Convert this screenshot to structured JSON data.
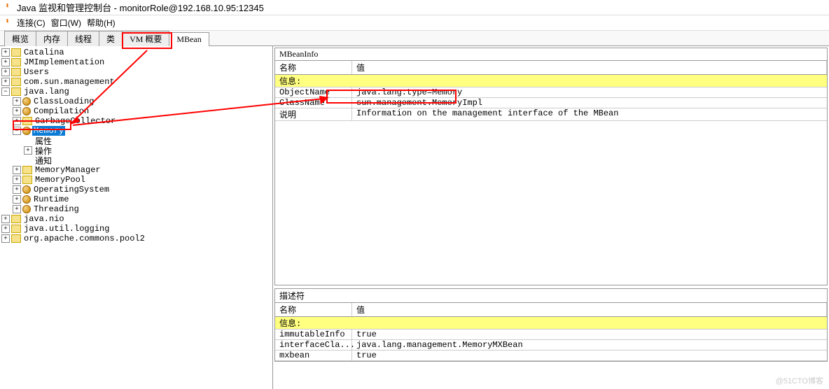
{
  "title": "Java 监视和管理控制台 - monitorRole@192.168.10.95:12345",
  "menu": {
    "connect": "连接(C)",
    "window": "窗口(W)",
    "help": "帮助(H)"
  },
  "tabs": [
    "概览",
    "内存",
    "线程",
    "类",
    "VM 概要",
    "MBean"
  ],
  "tree": {
    "catalina": "Catalina",
    "jmimpl": "JMImplementation",
    "users": "Users",
    "com_sun": "com.sun.management",
    "java_lang": "java.lang",
    "classloading": "ClassLoading",
    "compilation": "Compilation",
    "gc": "GarbageCollector",
    "memory": "Memory",
    "attr": "属性",
    "ops": "操作",
    "notif": "通知",
    "memmgr": "MemoryManager",
    "mempool": "MemoryPool",
    "os": "OperatingSystem",
    "runtime": "Runtime",
    "threading": "Threading",
    "java_nio": "java.nio",
    "java_util_log": "java.util.logging",
    "org_apache": "org.apache.commons.pool2"
  },
  "mbeaninfo": {
    "title": "MBeanInfo",
    "h1": "名称",
    "h2": "值",
    "section": "信息:",
    "r1k": "ObjectName",
    "r1v": "java.lang:type=Memory",
    "r2k": "ClassName",
    "r2v": "sun.management.MemoryImpl",
    "r3k": "说明",
    "r3v": "Information on the management interface of the MBean"
  },
  "descriptor": {
    "title": "描述符",
    "h1": "名称",
    "h2": "值",
    "section": "信息:",
    "r1k": "immutableInfo",
    "r1v": "true",
    "r2k": "interfaceCla...",
    "r2v": "java.lang.management.MemoryMXBean",
    "r3k": "mxbean",
    "r3v": "true"
  },
  "watermark": "@51CTO博客"
}
